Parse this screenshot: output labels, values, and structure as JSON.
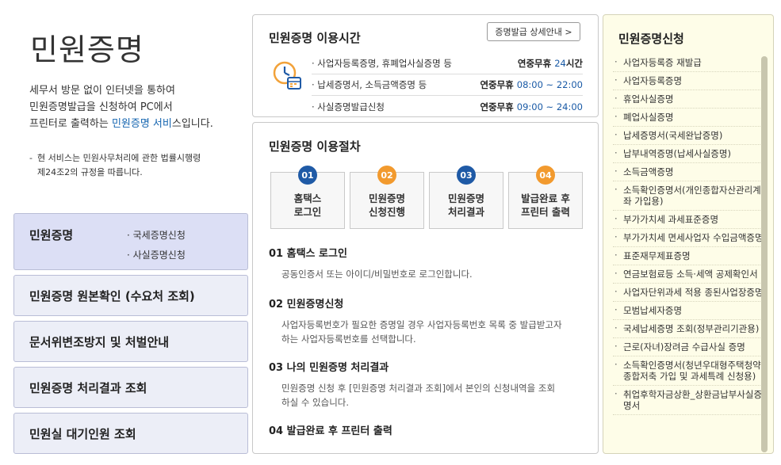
{
  "left": {
    "title": "민원증명",
    "intro_line1": "세무서 방문 없이 인터넷을 통하여",
    "intro_line2": "민원증명발급을 신청하여 PC에서",
    "intro_line3_pre": "프린터로 출력하는 ",
    "intro_line3_hl": "민원증명 서비",
    "intro_line3_post": "스입니다.",
    "note_line1": "현 서비스는 민원사무처리에 관한 법률시행령",
    "note_line2": "제24조2의 규정을 따릅니다.",
    "menu": [
      {
        "label": "민원증명",
        "subs": [
          "· 국세증명신청",
          "· 사실증명신청"
        ]
      },
      {
        "label": "민원증명 원본확인 (수요처 조회)"
      },
      {
        "label": "문서위변조방지 및 처벌안내"
      },
      {
        "label": "민원증명 처리결과 조회"
      },
      {
        "label": "민원실 대기인원 조회"
      }
    ]
  },
  "hours": {
    "title": "민원증명 이용시간",
    "detail_button": "증명발급 상세안내 >",
    "rows": [
      {
        "service": "· 사업자등록증명, 휴폐업사실증명 등",
        "time_label": "연중무휴 ",
        "time_value": "24",
        "time_suffix": "시간"
      },
      {
        "service": "· 납세증명서, 소득금액증명 등",
        "time_label": "연중무휴 ",
        "time_value": "08:00 ~ 22:00",
        "time_suffix": ""
      },
      {
        "service": "· 사실증명발급신청",
        "time_label": "연중무휴 ",
        "time_value": "09:00 ~ 24:00",
        "time_suffix": ""
      }
    ]
  },
  "procedure": {
    "title": "민원증명 이용절차",
    "steps": [
      {
        "num": "01",
        "line1": "홈택스",
        "line2": "로그인",
        "color": "#1f5aa6"
      },
      {
        "num": "02",
        "line1": "민원증명",
        "line2": "신청진행",
        "color": "#f29a2e"
      },
      {
        "num": "03",
        "line1": "민원증명",
        "line2": "처리결과",
        "color": "#1f5aa6"
      },
      {
        "num": "04",
        "line1": "발급완료 후",
        "line2": "프린터 출력",
        "color": "#f29a2e"
      }
    ],
    "descriptions": [
      {
        "heading": "01 홈택스 로그인",
        "line1": "공동인증서 또는 아이디/비밀번호로 로그인합니다.",
        "line2": ""
      },
      {
        "heading": "02 민원증명신청",
        "line1": "사업자등록번호가 필요한 증명일 경우 사업자등록번호 목록 중 발급받고자",
        "line2": "하는 사업자등록번호를 선택합니다."
      },
      {
        "heading": "03 나의 민원증명 처리결과",
        "line1": "민원증명 신청 후 [민원증명 처리결과 조회]에서 본인의 신청내역을 조회",
        "line2": "하실 수 있습니다."
      },
      {
        "heading": "04 발급완료 후 프린터 출력",
        "line1": "",
        "line2": ""
      }
    ]
  },
  "apply": {
    "title": "민원증명신청",
    "items": [
      "사업자등록증 재발급",
      "사업자등록증명",
      "휴업사실증명",
      "폐업사실증명",
      "납세증명서(국세완납증명)",
      "납부내역증명(납세사실증명)",
      "소득금액증명",
      "소득확인증명서(개인종합자산관리계좌 가입용)",
      "부가가치세 과세표준증명",
      "부가가치세 면세사업자 수입금액증명",
      "표준재무제표증명",
      "연금보험료등 소득·세액 공제확인서",
      "사업자단위과세 적용 종된사업장증명",
      "모범납세자증명",
      "국세납세증명 조회(정부관리기관용)",
      "근로(자녀)장려금 수급사실 증명",
      "소득확인증명서(청년우대형주택청약종합저축 가입 및 과세특례 신청용)",
      "취업후학자금상환_상환금납부사실증명서"
    ]
  }
}
